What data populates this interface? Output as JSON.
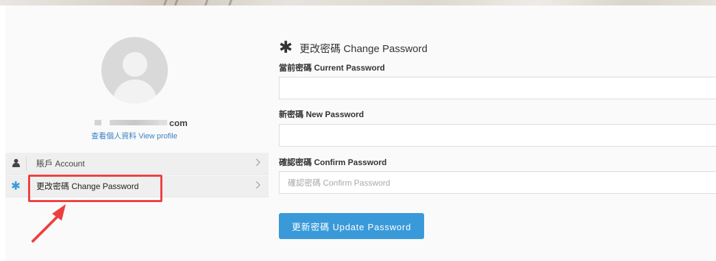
{
  "profile": {
    "email_suffix": "com",
    "view_profile_label": "查看個人資料 View profile"
  },
  "sidebar": {
    "items": [
      {
        "label": "賬戶 Account",
        "icon": "user-icon"
      },
      {
        "label": "更改密碼 Change Password",
        "icon": "asterisk-icon"
      }
    ]
  },
  "form": {
    "title": "更改密碼 Change Password",
    "current_password_label": "當前密碼 Current Password",
    "new_password_label": "新密碼 New Password",
    "confirm_password_label": "確認密碼 Confirm Password",
    "confirm_password_placeholder": "確認密碼 Confirm Password",
    "submit_label": "更新密碼 Update Password"
  },
  "colors": {
    "accent": "#3a9ad9",
    "highlight": "#ee3f3f",
    "link": "#3a7fc4"
  }
}
